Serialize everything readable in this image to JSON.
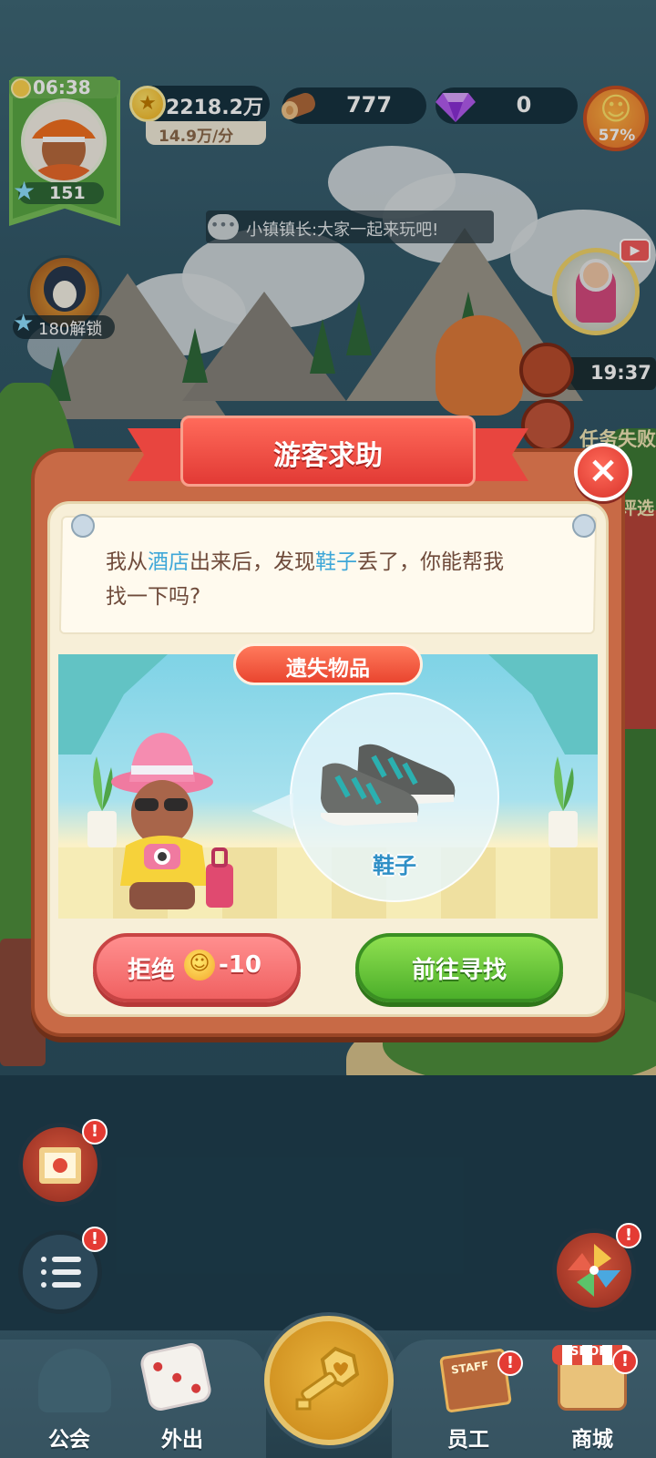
{
  "hud": {
    "time": "06:38",
    "level": "151",
    "coins": "2218.2万",
    "coin_rate": "14.9万/分",
    "wood": "777",
    "gems": "0",
    "happiness": "57%"
  },
  "chat": {
    "message": "小镇镇长:大家一起来玩吧!"
  },
  "side": {
    "unlock_text": "180解锁",
    "ship_timer": "19:37",
    "task_failed": "任务失败",
    "evaluate": "评选"
  },
  "dialog": {
    "title": "游客求助",
    "message_parts": [
      "我从",
      "酒店",
      "出来后，发现",
      "鞋子",
      "丢了，你能帮我",
      "找一下吗?"
    ],
    "lost_tag": "遗失物品",
    "item_name": "鞋子",
    "reject_label": "拒绝",
    "reject_cost": "-10",
    "go_label": "前往寻找",
    "close_symbol": "×"
  },
  "nav": {
    "guild": "公会",
    "outing": "外出",
    "staff": "员工",
    "shop": "商城",
    "staff_sign": "STAFF",
    "shop_sign": "SHOP"
  },
  "alerts": {
    "symbol": "!"
  },
  "icons": {
    "coin": "coin-icon",
    "wood": "wood-log-icon",
    "gem": "purple-gem-icon",
    "happy": "smiley-face-icon",
    "chat": "speech-bubble-icon",
    "close": "close-icon",
    "menu": "list-menu-icon",
    "key": "golden-key-icon",
    "dice": "dice-icon"
  },
  "colors": {
    "accent_red": "#e8453f",
    "accent_green": "#4caf2a",
    "highlight_blue": "#3ea7d8",
    "panel_brown": "#c86a46",
    "panel_cream": "#f7efd8"
  }
}
